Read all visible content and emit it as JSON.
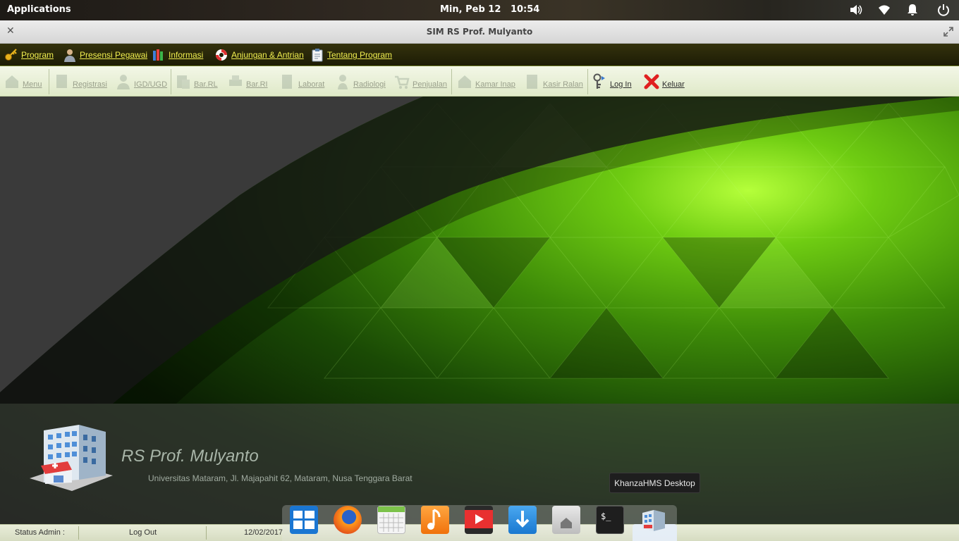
{
  "system_bar": {
    "applications_label": "Applications",
    "datetime": "Min, Peb 12   10:54"
  },
  "window": {
    "title": "SIM RS Prof. Mulyanto"
  },
  "menubar": {
    "items": [
      "Program",
      "Presensi Pegawai",
      "Informasi",
      "Anjungan & Antrian",
      "Tentang Program"
    ]
  },
  "toolbar": {
    "items": [
      "Menu",
      "Registrasi",
      "IGD/UGD",
      "Bar.RL",
      "Bar.RI",
      "Laborat",
      "Radiologi",
      "Penjualan",
      "Kamar Inap",
      "Kasir Ralan",
      "Log In",
      "Keluar"
    ]
  },
  "hospital": {
    "name": "RS Prof. Mulyanto",
    "address": "Universitas Mataram, Jl. Majapahit 62, Mataram, Nusa Tenggara Barat"
  },
  "tooltip": "KhanzaHMS Desktop",
  "statusbar": {
    "status": "Status Admin :",
    "logout": "Log Out",
    "date": "12/02/2017"
  },
  "dock": {
    "apps": [
      "multitasking-view",
      "firefox",
      "calendar",
      "music",
      "videos",
      "appcenter",
      "files",
      "terminal",
      "khanzahms-desktop"
    ]
  }
}
